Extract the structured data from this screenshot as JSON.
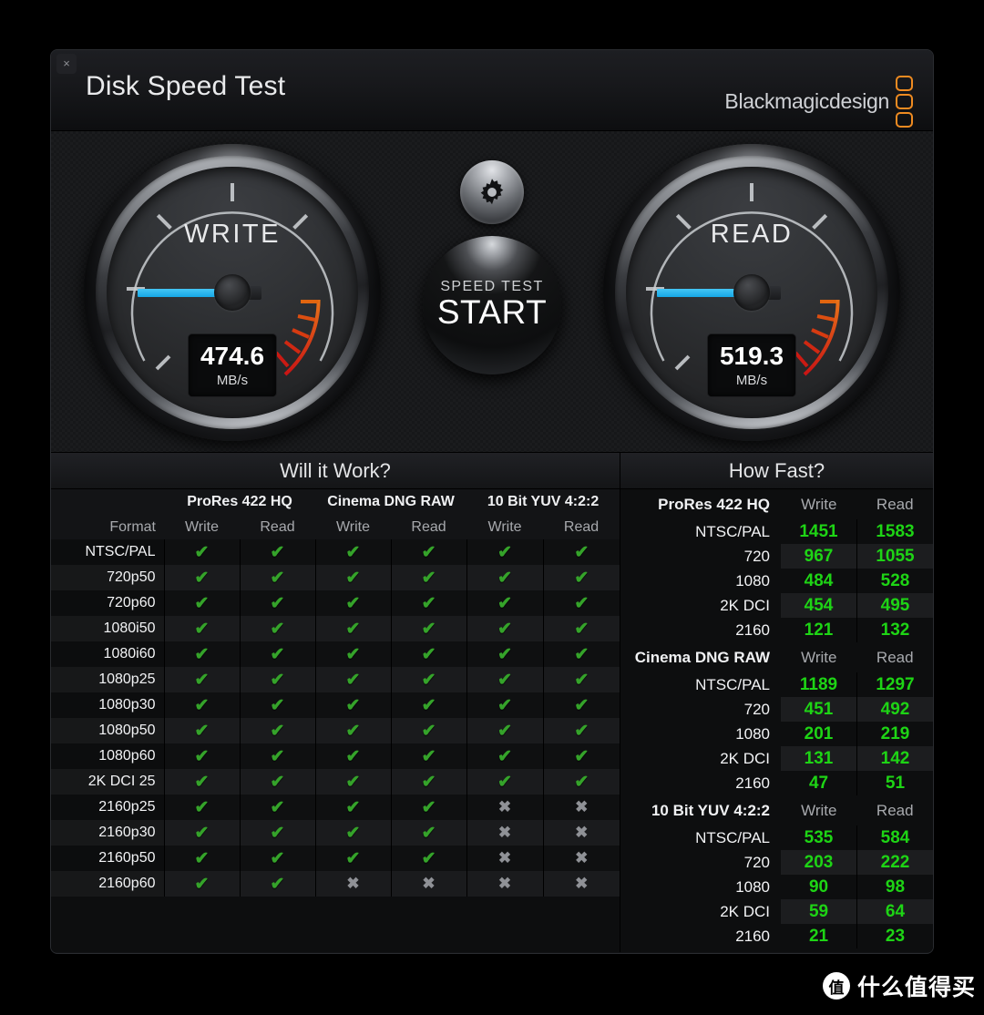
{
  "window": {
    "title": "Disk Speed Test",
    "close_label": "×",
    "brand": "Blackmagicdesign"
  },
  "gauges": {
    "write": {
      "label": "WRITE",
      "value": "474.6",
      "unit": "MB/s",
      "needle_deg": 0
    },
    "read": {
      "label": "READ",
      "value": "519.3",
      "unit": "MB/s",
      "needle_deg": 0
    }
  },
  "controls": {
    "gear_label": "settings-gear",
    "start_sub": "SPEED TEST",
    "start_main": "START"
  },
  "will_it_work": {
    "title": "Will it Work?",
    "codecs": [
      "ProRes 422 HQ",
      "Cinema DNG RAW",
      "10 Bit YUV 4:2:2"
    ],
    "sub_headers": [
      "Format",
      "Write",
      "Read",
      "Write",
      "Read",
      "Write",
      "Read"
    ],
    "tick_glyph": "✔",
    "cross_glyph": "✖",
    "rows": [
      {
        "format": "NTSC/PAL",
        "marks": [
          true,
          true,
          true,
          true,
          true,
          true
        ]
      },
      {
        "format": "720p50",
        "marks": [
          true,
          true,
          true,
          true,
          true,
          true
        ]
      },
      {
        "format": "720p60",
        "marks": [
          true,
          true,
          true,
          true,
          true,
          true
        ]
      },
      {
        "format": "1080i50",
        "marks": [
          true,
          true,
          true,
          true,
          true,
          true
        ]
      },
      {
        "format": "1080i60",
        "marks": [
          true,
          true,
          true,
          true,
          true,
          true
        ]
      },
      {
        "format": "1080p25",
        "marks": [
          true,
          true,
          true,
          true,
          true,
          true
        ]
      },
      {
        "format": "1080p30",
        "marks": [
          true,
          true,
          true,
          true,
          true,
          true
        ]
      },
      {
        "format": "1080p50",
        "marks": [
          true,
          true,
          true,
          true,
          true,
          true
        ]
      },
      {
        "format": "1080p60",
        "marks": [
          true,
          true,
          true,
          true,
          true,
          true
        ]
      },
      {
        "format": "2K DCI 25",
        "marks": [
          true,
          true,
          true,
          true,
          true,
          true
        ]
      },
      {
        "format": "2160p25",
        "marks": [
          true,
          true,
          true,
          true,
          false,
          false
        ]
      },
      {
        "format": "2160p30",
        "marks": [
          true,
          true,
          true,
          true,
          false,
          false
        ]
      },
      {
        "format": "2160p50",
        "marks": [
          true,
          true,
          true,
          true,
          false,
          false
        ]
      },
      {
        "format": "2160p60",
        "marks": [
          true,
          true,
          false,
          false,
          false,
          false
        ]
      }
    ]
  },
  "how_fast": {
    "title": "How Fast?",
    "write_label": "Write",
    "read_label": "Read",
    "groups": [
      {
        "name": "ProRes 422 HQ",
        "rows": [
          {
            "res": "NTSC/PAL",
            "write": "1451",
            "read": "1583"
          },
          {
            "res": "720",
            "write": "967",
            "read": "1055"
          },
          {
            "res": "1080",
            "write": "484",
            "read": "528"
          },
          {
            "res": "2K DCI",
            "write": "454",
            "read": "495"
          },
          {
            "res": "2160",
            "write": "121",
            "read": "132"
          }
        ]
      },
      {
        "name": "Cinema DNG RAW",
        "rows": [
          {
            "res": "NTSC/PAL",
            "write": "1189",
            "read": "1297"
          },
          {
            "res": "720",
            "write": "451",
            "read": "492"
          },
          {
            "res": "1080",
            "write": "201",
            "read": "219"
          },
          {
            "res": "2K DCI",
            "write": "131",
            "read": "142"
          },
          {
            "res": "2160",
            "write": "47",
            "read": "51"
          }
        ]
      },
      {
        "name": "10 Bit YUV 4:2:2",
        "rows": [
          {
            "res": "NTSC/PAL",
            "write": "535",
            "read": "584"
          },
          {
            "res": "720",
            "write": "203",
            "read": "222"
          },
          {
            "res": "1080",
            "write": "90",
            "read": "98"
          },
          {
            "res": "2K DCI",
            "write": "59",
            "read": "64"
          },
          {
            "res": "2160",
            "write": "21",
            "read": "23"
          }
        ]
      }
    ]
  },
  "watermark": {
    "badge": "值",
    "text": "什么值得买"
  },
  "colors": {
    "accent_orange": "#ef8b21",
    "needle_blue": "#16a7e6",
    "tick_green": "#35a32a",
    "value_green": "#1ed415",
    "cross_gray": "#8f9196"
  }
}
